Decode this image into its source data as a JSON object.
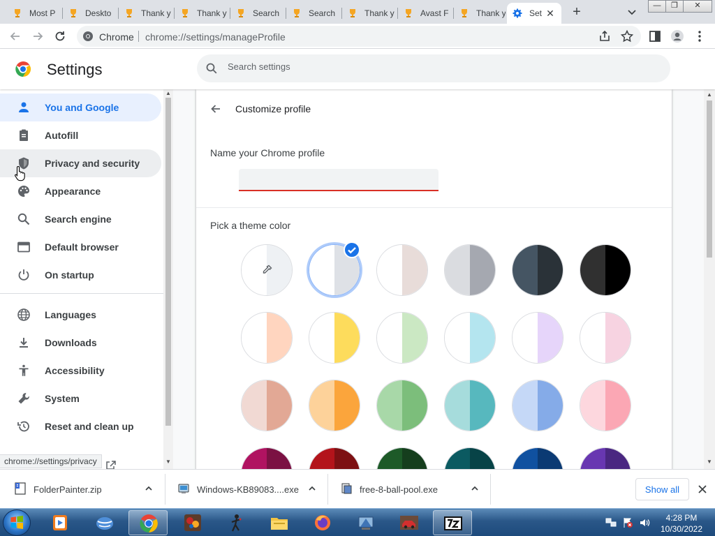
{
  "browser": {
    "tabs": [
      {
        "label": "Most P"
      },
      {
        "label": "Deskto"
      },
      {
        "label": "Thank y"
      },
      {
        "label": "Thank y"
      },
      {
        "label": "Search"
      },
      {
        "label": "Search"
      },
      {
        "label": "Thank y"
      },
      {
        "label": "Avast F"
      },
      {
        "label": "Thank y"
      },
      {
        "label": "Set"
      }
    ],
    "site_label": "Chrome",
    "url": "chrome://settings/manageProfile"
  },
  "settings": {
    "title": "Settings",
    "search_placeholder": "Search settings",
    "nav": [
      {
        "label": "You and Google",
        "icon": "person-icon"
      },
      {
        "label": "Autofill",
        "icon": "clipboard-icon"
      },
      {
        "label": "Privacy and security",
        "icon": "shield-icon"
      },
      {
        "label": "Appearance",
        "icon": "palette-icon"
      },
      {
        "label": "Search engine",
        "icon": "search-icon"
      },
      {
        "label": "Default browser",
        "icon": "browser-window-icon"
      },
      {
        "label": "On startup",
        "icon": "power-icon"
      },
      {
        "label": "Languages",
        "icon": "globe-icon"
      },
      {
        "label": "Downloads",
        "icon": "download-icon"
      },
      {
        "label": "Accessibility",
        "icon": "accessibility-icon"
      },
      {
        "label": "System",
        "icon": "wrench-icon"
      },
      {
        "label": "Reset and clean up",
        "icon": "history-icon"
      }
    ],
    "status_url": "chrome://settings/privacy"
  },
  "profile": {
    "title": "Customize profile",
    "name_label": "Name your Chrome profile",
    "name_value": "",
    "theme_label": "Pick a theme color",
    "swatches": [
      [
        "#ffffff",
        "#eef1f4"
      ],
      [
        "#ffffff",
        "#dee1e6"
      ],
      [
        "#ffffff",
        "#e8dcd9"
      ],
      [
        "#dadce0",
        "#a5a8b0"
      ],
      [
        "#455563",
        "#2a3238"
      ],
      [
        "#303030",
        "#000000"
      ],
      [
        "#ffffff",
        "#ffd5bf"
      ],
      [
        "#ffffff",
        "#fddc5c"
      ],
      [
        "#ffffff",
        "#cbe8c3"
      ],
      [
        "#ffffff",
        "#b4e5ef"
      ],
      [
        "#ffffff",
        "#e6d5fa"
      ],
      [
        "#ffffff",
        "#f7d3e1"
      ],
      [
        "#f1d9d3",
        "#e2a895"
      ],
      [
        "#fdd29a",
        "#fba53c"
      ],
      [
        "#a8d8a8",
        "#7cbe7b"
      ],
      [
        "#a6dcdc",
        "#57b8be"
      ],
      [
        "#c5d8f7",
        "#85abe8"
      ],
      [
        "#fdd7de",
        "#fba7b4"
      ],
      [
        "#b01361",
        "#7b1143"
      ],
      [
        "#b3141b",
        "#7d1013"
      ],
      [
        "#1d5a28",
        "#153e1d"
      ],
      [
        "#0b5a61",
        "#074347"
      ],
      [
        "#1051a0",
        "#0b3a73"
      ],
      [
        "#6837b1",
        "#4a2781"
      ]
    ],
    "selected_index": 1
  },
  "downloads": {
    "items": [
      {
        "name": "FolderPainter.zip"
      },
      {
        "name": "Windows-KB89083....exe"
      },
      {
        "name": "free-8-ball-pool.exe"
      }
    ],
    "show_all": "Show all"
  },
  "taskbar": {
    "time": "4:28 PM",
    "date": "10/30/2022"
  },
  "colors": {
    "accent": "#1a73e8",
    "error": "#d93025"
  }
}
